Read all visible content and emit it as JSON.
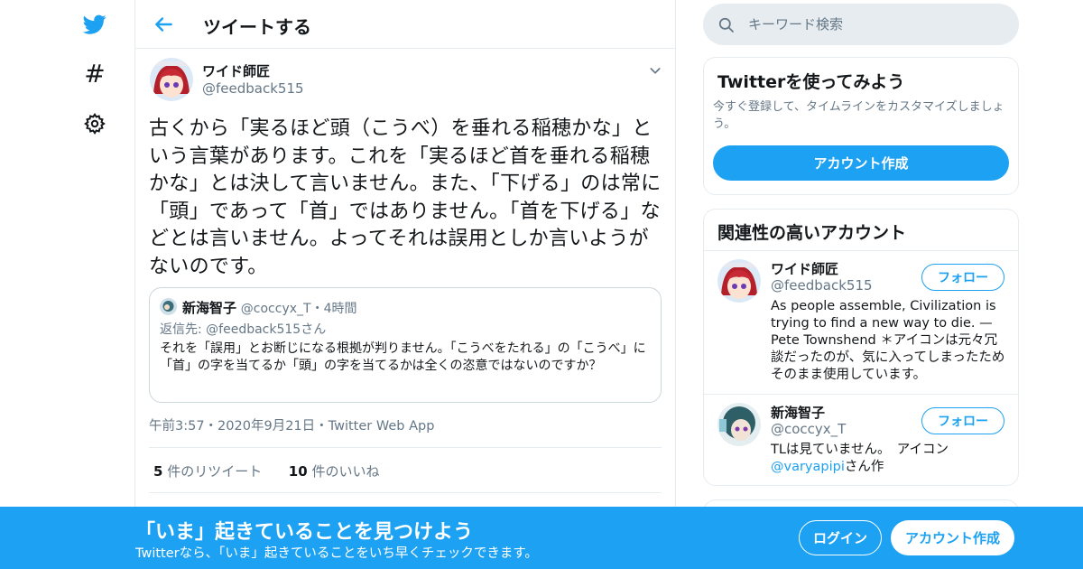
{
  "colors": {
    "accent": "#1da1f2",
    "text": "#14171a",
    "muted": "#657786",
    "border": "#e6ecf0"
  },
  "nav": {
    "icons": [
      "twitter-bird-icon",
      "hashtag-icon",
      "gear-icon"
    ],
    "hash_glyph": "#"
  },
  "header": {
    "title": "ツイートする"
  },
  "tweet": {
    "author_name": "ワイド師匠",
    "author_handle": "@feedback515",
    "text": "古くから「実るほど頭（こうべ）を垂れる稲穂かな」という言葉があります。これを「実るほど首を垂れる稲穂かな」とは決して言いません。また、「下げる」のは常に「頭」であって「首」ではありません。「首を下げる」などとは言いません。よってそれは誤用としか言いようがないのです。",
    "timestamp": "午前3:57・2020年9月21日・Twitter Web App",
    "retweets_count": "5",
    "retweets_label": "件のリツイート",
    "likes_count": "10",
    "likes_label": "件のいいね"
  },
  "quote": {
    "name": "新海智子",
    "handle_time": "@coccyx_T・4時間",
    "reply_to": "返信先: @feedback515さん",
    "text": "それを「誤用」とお断じになる根拠が判りません。「こうべをたれる」の「こうべ」に「首」の字を当てるか「頭」の字を当てるかは全くの恣意ではないのですか？"
  },
  "search": {
    "placeholder": "キーワード検索"
  },
  "signup_card": {
    "title": "Twitterを使ってみよう",
    "description": "今すぐ登録して、タイムラインをカスタマイズしましょう。",
    "button": "アカウント作成"
  },
  "related": {
    "title": "関連性の高いアカウント",
    "accounts": [
      {
        "name": "ワイド師匠",
        "handle": "@feedback515",
        "bio": "As people assemble, Civilization is trying to find a new way to die. — Pete Townshend ＊アイコンは元々冗談だったのが、気に入ってしまったためそのまま使用しています。",
        "follow": "フォロー"
      },
      {
        "name": "新海智子",
        "handle": "@coccyx_T",
        "bio_prefix": "TLは見ていません。　アイコン",
        "bio_link": "@varyapipi",
        "bio_suffix": "さん作",
        "follow": "フォロー"
      }
    ]
  },
  "banner": {
    "title": "「いま」起きていることを見つけよう",
    "subtitle": "Twitterなら、「いま」起きていることをいち早くチェックできます。",
    "login": "ログイン",
    "signup": "アカウント作成"
  }
}
